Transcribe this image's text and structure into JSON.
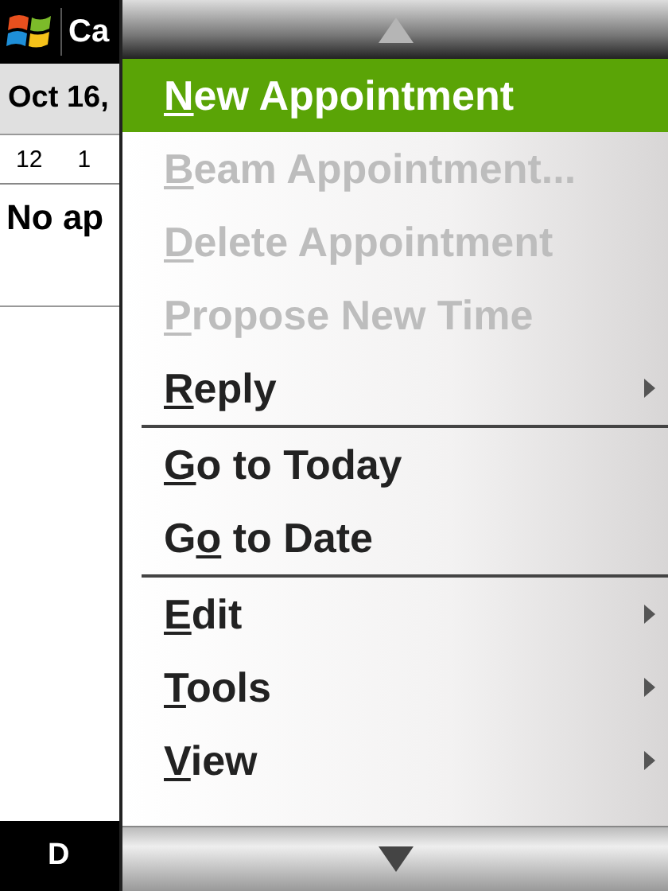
{
  "title_bar": {
    "title": "Ca"
  },
  "calendar": {
    "date": "Oct 16,",
    "hours": [
      "12",
      "1"
    ],
    "message": "No ap"
  },
  "softkey_bar": {
    "left": "D"
  },
  "menu": {
    "groups": [
      [
        {
          "accesskey": "N",
          "text_after": "ew Appointment",
          "selected": true,
          "disabled": false,
          "submenu": false
        },
        {
          "accesskey": "B",
          "text_after": "eam Appointment...",
          "selected": false,
          "disabled": true,
          "submenu": false
        },
        {
          "accesskey": "D",
          "text_after": "elete Appointment",
          "selected": false,
          "disabled": true,
          "submenu": false
        },
        {
          "accesskey": "P",
          "text_after": "ropose New Time",
          "selected": false,
          "disabled": true,
          "submenu": false
        },
        {
          "accesskey": "R",
          "text_after": "eply",
          "selected": false,
          "disabled": false,
          "submenu": true
        }
      ],
      [
        {
          "accesskey": "G",
          "text_after": "o to Today",
          "selected": false,
          "disabled": false,
          "submenu": false
        },
        {
          "text_before": "G",
          "accesskey": "o",
          "text_after": " to Date",
          "selected": false,
          "disabled": false,
          "submenu": false
        }
      ],
      [
        {
          "accesskey": "E",
          "text_after": "dit",
          "selected": false,
          "disabled": false,
          "submenu": true
        },
        {
          "accesskey": "T",
          "text_after": "ools",
          "selected": false,
          "disabled": false,
          "submenu": true
        },
        {
          "accesskey": "V",
          "text_after": "iew",
          "selected": false,
          "disabled": false,
          "submenu": true
        }
      ]
    ]
  }
}
